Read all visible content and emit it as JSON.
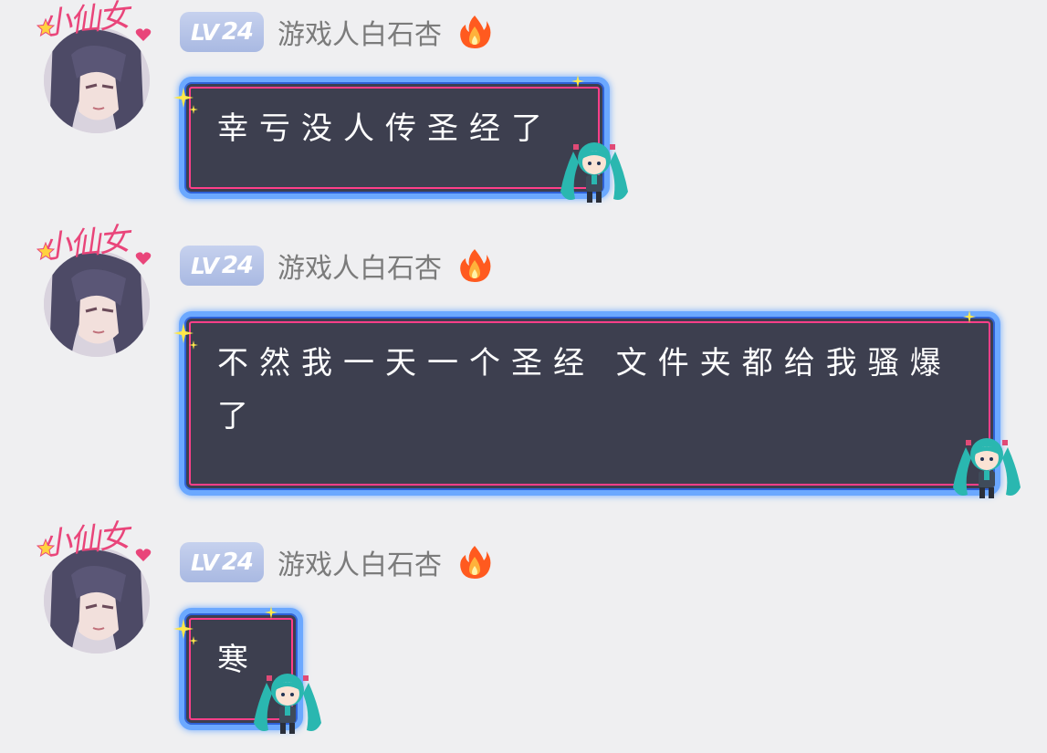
{
  "messages": [
    {
      "level_prefix": "LV",
      "level_number": "24",
      "username": "游戏人白石杏",
      "text": "幸亏没人传圣经了",
      "avatar_frame_text": "小仙女"
    },
    {
      "level_prefix": "LV",
      "level_number": "24",
      "username": "游戏人白石杏",
      "text": "不然我一天一个圣经 文件夹都给我骚爆了",
      "avatar_frame_text": "小仙女"
    },
    {
      "level_prefix": "LV",
      "level_number": "24",
      "username": "游戏人白石杏",
      "text": "寒",
      "avatar_frame_text": "小仙女"
    }
  ],
  "icons": {
    "fire": "fire-icon",
    "avatar_star": "star-icon",
    "bubble_sparkle": "sparkle-icon",
    "bubble_mascot": "chibi-mascot-icon"
  },
  "colors": {
    "background": "#efeff1",
    "level_badge": "#b2c0e6",
    "username": "#7b7b7b",
    "bubble_fill": "#3d3f4f",
    "bubble_outer_border": "#6ba8ff",
    "bubble_inner_border": "#ff3f89",
    "frame_pink": "#e9457a",
    "mascot_hair": "#2ab7b0"
  }
}
